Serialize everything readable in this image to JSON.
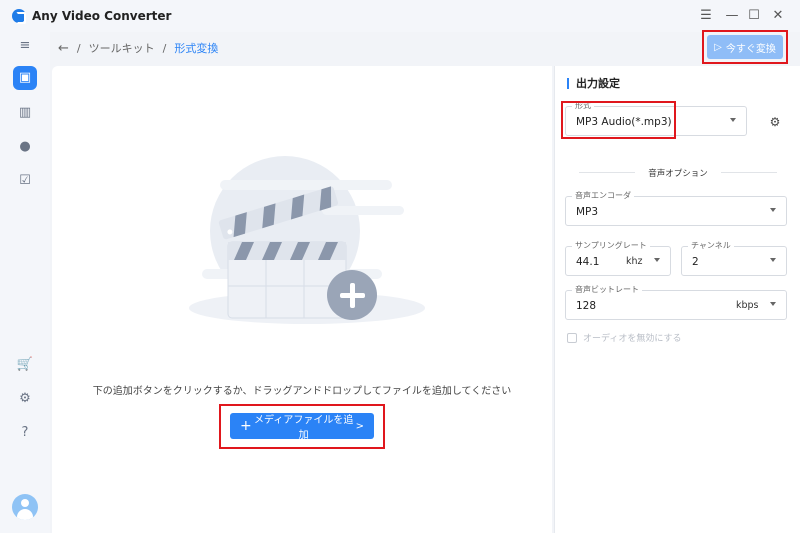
{
  "app": {
    "title": "Any Video Converter"
  },
  "window": {
    "menu_icon": "menu-icon",
    "minimize_icon": "minimize-icon",
    "maximize_icon": "maximize-icon",
    "close_icon": "close-icon"
  },
  "breadcrumb": {
    "back": "←",
    "sep1": "/",
    "item1": "ツールキット",
    "sep2": "/",
    "current": "形式変換"
  },
  "header": {
    "convert_label": "今すぐ変換",
    "convert_icon": "▷"
  },
  "sidebar": {
    "items": [
      {
        "name": "collapse",
        "glyph": "≡"
      },
      {
        "name": "toolkit",
        "glyph": "▣"
      },
      {
        "name": "map",
        "glyph": "▥"
      },
      {
        "name": "history",
        "glyph": "●"
      },
      {
        "name": "tasks",
        "glyph": "☑"
      },
      {
        "name": "cart",
        "glyph": "🛒"
      },
      {
        "name": "settings",
        "glyph": "⚙"
      },
      {
        "name": "help",
        "glyph": "?"
      }
    ]
  },
  "main": {
    "drop_text": "下の追加ボタンをクリックするか、ドラッグアンドドロップしてファイルを追加してください",
    "add_button": {
      "plus": "+",
      "label": "メディアファイルを追加",
      "chevron": ">"
    }
  },
  "output": {
    "title": "出力設定",
    "format": {
      "label": "形式",
      "value": "MP3 Audio(*.mp3)"
    },
    "audio_options_title": "音声オプション",
    "encoder": {
      "label": "音声エンコーダ",
      "value": "MP3"
    },
    "sample_rate": {
      "label": "サンプリングレート",
      "value": "44.1",
      "unit": "khz"
    },
    "channel": {
      "label": "チャンネル",
      "value": "2"
    },
    "bitrate": {
      "label": "音声ビットレート",
      "value": "128",
      "unit": "kbps"
    },
    "disable_audio": "オーディオを無効にする"
  },
  "colors": {
    "accent": "#2b83f6",
    "highlight": "#e0171d"
  }
}
